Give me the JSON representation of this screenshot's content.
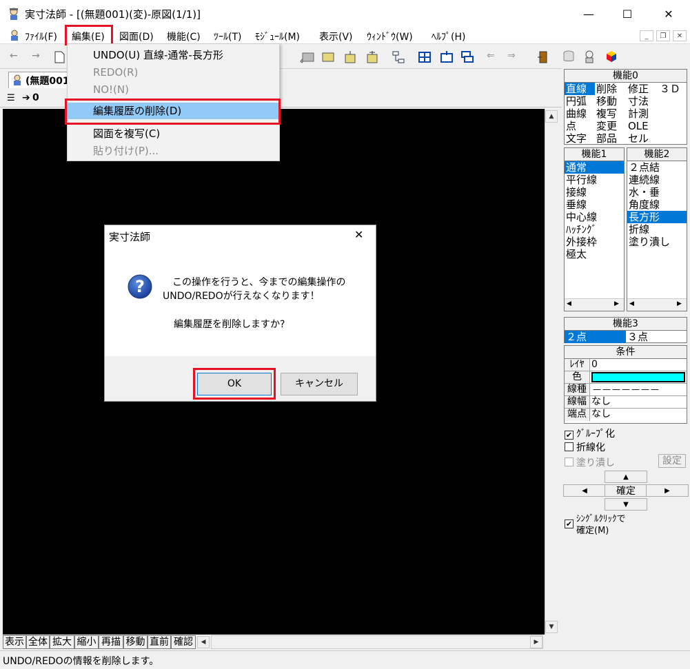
{
  "window": {
    "title": "実寸法師 - [(無題001)(変)-原図(1/1)]",
    "min": "—",
    "max": "☐",
    "close": "✕"
  },
  "menu": {
    "items": [
      "ﾌｧｲﾙ(F)",
      "編集(E)",
      "図面(D)",
      "機能(C)",
      "ﾂｰﾙ(T)",
      "ﾓｼﾞｭｰﾙ(M)",
      "表示(V)",
      "ｳｨﾝﾄﾞｳ(W)",
      "ﾍﾙﾌﾟ(H)"
    ]
  },
  "doc": {
    "tab_label": "(無題001",
    "layer_value": "0"
  },
  "dropdown": {
    "items": [
      {
        "label": "UNDO(U) 直線-通常-長方形",
        "disabled": false
      },
      {
        "label": "REDO(R)",
        "disabled": true
      },
      {
        "label": "NO!(N)",
        "disabled": true
      },
      {
        "label": "編集履歴の削除(D)",
        "disabled": false
      },
      {
        "label": "図面を複写(C)",
        "disabled": false
      },
      {
        "label": "貼り付け(P)...",
        "disabled": true
      }
    ]
  },
  "dialog": {
    "title": "実寸法師",
    "line1": "この操作を行うと、今までの編集操作の",
    "line2": "UNDO/REDOが行えなくなります！",
    "line3": "編集履歴を削除しますか?",
    "ok": "OK",
    "cancel": "キャンセル"
  },
  "bottombar": {
    "buttons": [
      "表示",
      "全体",
      "拡大",
      "縮小",
      "再描",
      "移動",
      "直前",
      "確認"
    ]
  },
  "status": {
    "text": "UNDO/REDOの情報を削除します。"
  },
  "panel": {
    "kino0": {
      "title": "機能0",
      "rows": [
        [
          "直線",
          "削除",
          "修正",
          "３Ｄ"
        ],
        [
          "円弧",
          "移動",
          "寸法",
          ""
        ],
        [
          "曲線",
          "複写",
          "計測",
          ""
        ],
        [
          "点",
          "変更",
          "OLE",
          ""
        ],
        [
          "文字",
          "部品",
          "セル",
          ""
        ]
      ],
      "selected": "直線"
    },
    "kino1": {
      "title": "機能1",
      "items": [
        "通常",
        "平行線",
        "接線",
        "垂線",
        "中心線",
        "ﾊｯﾁﾝｸﾞ",
        "外接枠",
        "極太"
      ],
      "selected": "通常"
    },
    "kino2": {
      "title": "機能2",
      "items": [
        "２点結",
        "連続線",
        "水・垂",
        "角度線",
        "長方形",
        "折線",
        "塗り潰し"
      ],
      "selected": "長方形"
    },
    "kino3": {
      "title": "機能3",
      "items": [
        "２点",
        "３点"
      ],
      "selected": "２点"
    },
    "conditions": {
      "title": "条件",
      "rows": [
        {
          "label": "ﾚｲﾔ",
          "value": "0"
        },
        {
          "label": "色",
          "value": ""
        },
        {
          "label": "線種",
          "value": "———————"
        },
        {
          "label": "線幅",
          "value": "なし"
        },
        {
          "label": "端点",
          "value": "なし"
        }
      ],
      "color_value": "#00ffff"
    },
    "options": {
      "group": "ｸﾞﾙｰﾌﾟ化",
      "polyline": "折線化",
      "fill": "塗り潰し",
      "settings": "設定",
      "confirm": "確定",
      "singleclick_line1": "ｼﾝｸﾞﾙｸﾘｯｸで",
      "singleclick_line2": "確定(M)"
    }
  },
  "colors": {
    "selection": "#0078d7",
    "highlight_box": "#e81123",
    "menu_hover": "#91c9f7",
    "canvas": "#000000"
  }
}
